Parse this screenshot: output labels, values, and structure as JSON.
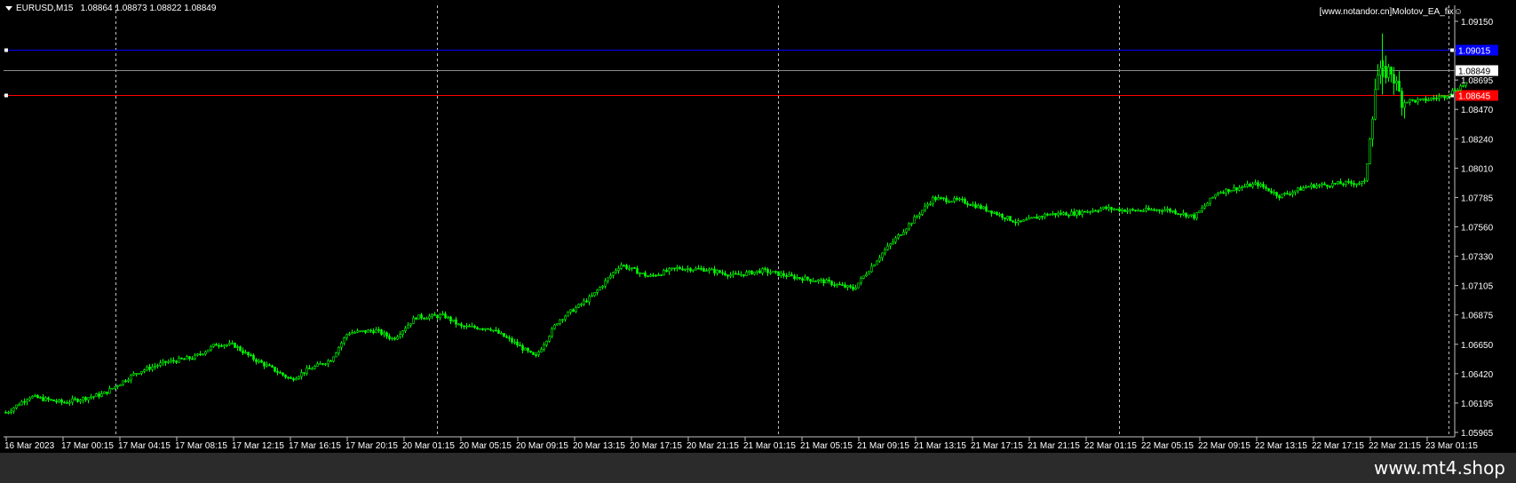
{
  "window": {
    "symbol_label": "EURUSD,M15",
    "ohlc_label": "1.08864 1.08873 1.08822 1.08849",
    "watermark": "[www.notandor.cn]Molotov_EA_fix☺"
  },
  "footer": {
    "site": "www.mt4.shop"
  },
  "colors": {
    "background": "#000000",
    "candle": "#00ff00",
    "axis": "#c0c0c0",
    "grid": "#c0c0c0",
    "blue_line": "#0000ff",
    "red_line": "#ff0000",
    "gray_line": "#8c8c8c"
  },
  "chart_data": {
    "type": "candlestick",
    "symbol": "EURUSD",
    "timeframe": "M15",
    "ylim": [
      1.0585,
      1.0938
    ],
    "price_ticks": [
      "1.09150",
      "1.08925",
      "1.08695",
      "1.08470",
      "1.08240",
      "1.08010",
      "1.07785",
      "1.07560",
      "1.07330",
      "1.07105",
      "1.06875",
      "1.06650",
      "1.06420",
      "1.06195",
      "1.05965"
    ],
    "time_labels": [
      "16 Mar 2023",
      "17 Mar 00:15",
      "17 Mar 04:15",
      "17 Mar 08:15",
      "17 Mar 12:15",
      "17 Mar 16:15",
      "17 Mar 20:15",
      "20 Mar 01:15",
      "20 Mar 05:15",
      "20 Mar 09:15",
      "20 Mar 13:15",
      "20 Mar 17:15",
      "20 Mar 21:15",
      "21 Mar 01:15",
      "21 Mar 05:15",
      "21 Mar 09:15",
      "21 Mar 13:15",
      "21 Mar 17:15",
      "21 Mar 21:15",
      "22 Mar 01:15",
      "22 Mar 05:15",
      "22 Mar 09:15",
      "22 Mar 13:15",
      "22 Mar 17:15",
      "22 Mar 21:15",
      "23 Mar 01:15"
    ],
    "day_separators_at_label_index": [
      1,
      6.65,
      12.65,
      18.65,
      24.45
    ],
    "horizontal_lines": [
      {
        "name": "blue-level",
        "price": 1.09015,
        "label": "1.09015",
        "color": "#0000ff"
      },
      {
        "name": "bid-level",
        "price": 1.08849,
        "label": "1.08849",
        "color": "#8c8c8c"
      },
      {
        "name": "red-level",
        "price": 1.08645,
        "label": "1.08645",
        "color": "#ff0000"
      }
    ],
    "price_path": [
      [
        0,
        1.0605
      ],
      [
        0.4,
        1.0618
      ],
      [
        1,
        1.0613
      ],
      [
        1.7,
        1.062
      ],
      [
        2.3,
        1.0638
      ],
      [
        2.8,
        1.0646
      ],
      [
        3.3,
        1.065
      ],
      [
        3.7,
        1.0661
      ],
      [
        4,
        1.066
      ],
      [
        4.3,
        1.065
      ],
      [
        4.7,
        1.064
      ],
      [
        5.0,
        1.0632
      ],
      [
        5.3,
        1.064
      ],
      [
        5.7,
        1.0648
      ],
      [
        6.0,
        1.067
      ],
      [
        6.5,
        1.0672
      ],
      [
        6.8,
        1.0665
      ],
      [
        7.2,
        1.0683
      ],
      [
        7.7,
        1.0684
      ],
      [
        8.0,
        1.0675
      ],
      [
        8.5,
        1.0674
      ],
      [
        9.0,
        1.066
      ],
      [
        9.3,
        1.065
      ],
      [
        9.7,
        1.068
      ],
      [
        10.3,
        1.07
      ],
      [
        10.8,
        1.0726
      ],
      [
        11.3,
        1.0716
      ],
      [
        11.8,
        1.0723
      ],
      [
        12.3,
        1.0722
      ],
      [
        12.8,
        1.0717
      ],
      [
        13.3,
        1.0721
      ],
      [
        13.8,
        1.0716
      ],
      [
        14.4,
        1.0712
      ],
      [
        14.9,
        1.0706
      ],
      [
        15.4,
        1.0735
      ],
      [
        15.9,
        1.076
      ],
      [
        16.3,
        1.078
      ],
      [
        16.8,
        1.0778
      ],
      [
        17.3,
        1.077
      ],
      [
        17.8,
        1.076
      ],
      [
        18.3,
        1.0767
      ],
      [
        18.8,
        1.0768
      ],
      [
        19.3,
        1.0772
      ],
      [
        19.8,
        1.077
      ],
      [
        20.4,
        1.0771
      ],
      [
        20.9,
        1.0765
      ],
      [
        21.3,
        1.0785
      ],
      [
        22.0,
        1.0792
      ],
      [
        22.4,
        1.0782
      ],
      [
        22.9,
        1.079
      ],
      [
        23.4,
        1.0792
      ],
      [
        23.9,
        1.0793
      ],
      [
        24.1,
        1.088
      ],
      [
        24.35,
        1.0885
      ],
      [
        24.55,
        1.086
      ],
      [
        24.9,
        1.086
      ],
      [
        25.3,
        1.0864
      ],
      [
        25.7,
        1.0875
      ],
      [
        26.0,
        1.0883
      ]
    ],
    "spike_high": 1.0915
  }
}
